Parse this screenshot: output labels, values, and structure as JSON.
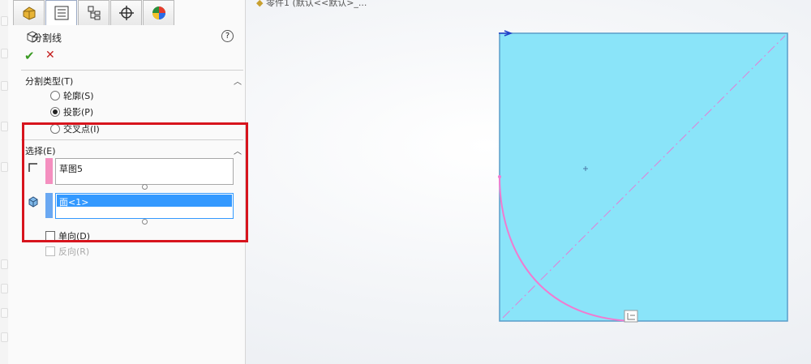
{
  "tabs": [
    {
      "name": "feature-manager",
      "icon": "feature-manager-icon"
    },
    {
      "name": "property-manager",
      "icon": "property-manager-icon"
    },
    {
      "name": "configuration-manager",
      "icon": "configuration-manager-icon"
    },
    {
      "name": "dimxpert",
      "icon": "dimxpert-crosshair-icon"
    },
    {
      "name": "display-manager",
      "icon": "display-manager-icon"
    }
  ],
  "header": {
    "title": "分割线",
    "help": "?"
  },
  "actions": {
    "ok": "✔",
    "cancel": "✕"
  },
  "split_type": {
    "title": "分割类型(T)",
    "options": [
      {
        "label": "轮廓(S)",
        "selected": false
      },
      {
        "label": "投影(P)",
        "selected": true
      },
      {
        "label": "交叉点(I)",
        "selected": false
      }
    ]
  },
  "selection": {
    "title": "选择(E)",
    "sketch_box": {
      "value": "草图5",
      "color": "#f48fbf"
    },
    "face_box": {
      "value": "面<1>",
      "color": "#6aa8f2"
    }
  },
  "options": {
    "single_direction": {
      "label": "单向(D)",
      "checked": false
    },
    "reverse_direction": {
      "label": "反向(R)",
      "checked": false,
      "disabled": true
    }
  },
  "viewport": {
    "title": "零件1 (默认<<默认>_...",
    "face_color": "#8ae4f9",
    "sketch_color": "#f07bd0",
    "highlight_color": "#d7141d"
  }
}
